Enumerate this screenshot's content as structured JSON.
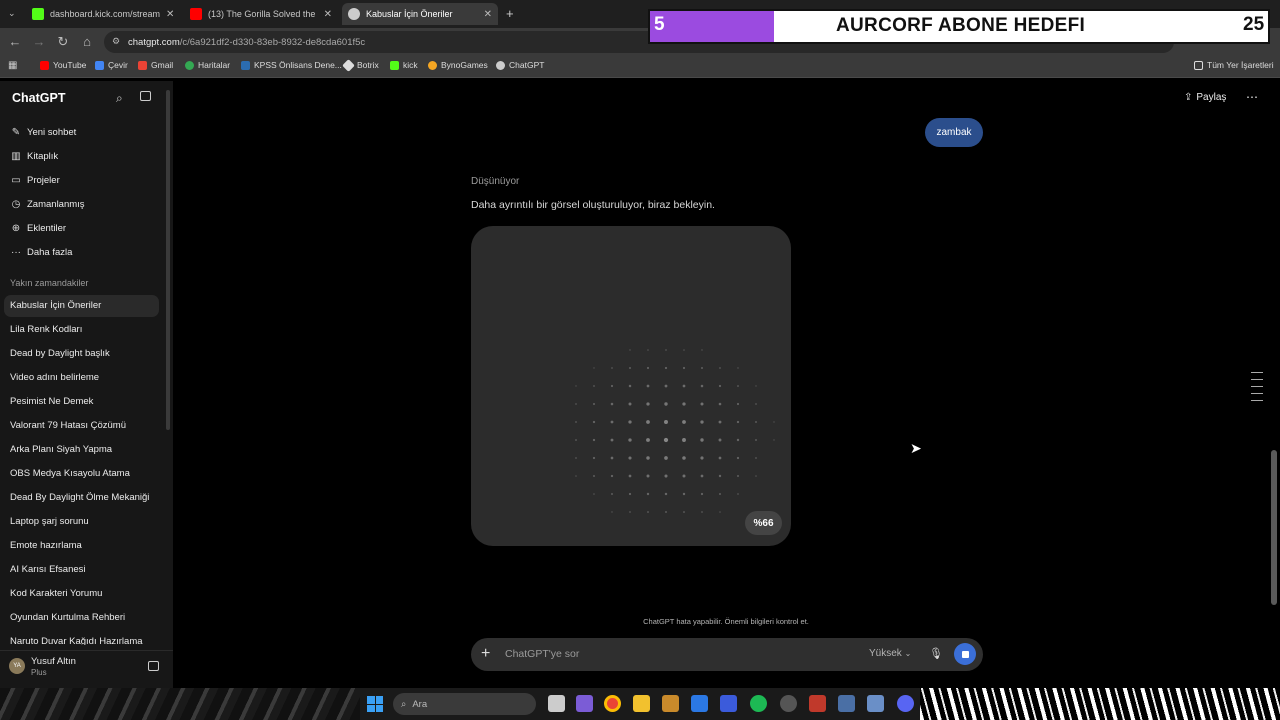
{
  "browser": {
    "tabs": [
      {
        "title": "dashboard.kick.com/stream",
        "favicon_color": "#53fc18"
      },
      {
        "title": "(13) The Gorilla Solved the Puzz",
        "favicon_color": "#ff0000"
      },
      {
        "title": "Kabuslar İçin Öneriler",
        "favicon_color": "#cccccc"
      }
    ],
    "new_tab": "+",
    "url_host": "chatgpt.com",
    "url_path": "/c/6a921df2-d330-83eb-8932-de8cda601f5c",
    "bookmarks": [
      {
        "label": "YouTube",
        "color": "#ff0000"
      },
      {
        "label": "Çevir",
        "color": "#4285f4"
      },
      {
        "label": "Gmail",
        "color": "#ea4335"
      },
      {
        "label": "Haritalar",
        "color": "#34a853"
      },
      {
        "label": "KPSS Önlisans Dene...",
        "color": "#2b6cb0"
      },
      {
        "label": "Botrix",
        "color": "#dddddd"
      },
      {
        "label": "kick",
        "color": "#53fc18"
      },
      {
        "label": "BynoGames",
        "color": "#f5a623"
      },
      {
        "label": "ChatGPT",
        "color": "#cccccc"
      }
    ],
    "all_bookmarks": "Tüm Yer İşaretleri"
  },
  "stream_overlay": {
    "count": "5",
    "title": "AURCORF ABONE HEDEFI",
    "goal": "25",
    "accent": "#9b4be0"
  },
  "sidebar": {
    "logo": "ChatGPT",
    "nav": [
      {
        "label": "Yeni sohbet",
        "icon": "✎"
      },
      {
        "label": "Kitaplık",
        "icon": "▥"
      },
      {
        "label": "Projeler",
        "icon": "▭"
      },
      {
        "label": "Zamanlanmış",
        "icon": "◷"
      },
      {
        "label": "Eklentiler",
        "icon": "⊕"
      },
      {
        "label": "Daha fazla",
        "icon": "···"
      }
    ],
    "recent_heading": "Yakın zamandakiler",
    "conversations": [
      "Kabuslar İçin Öneriler",
      "Lila Renk Kodları",
      "Dead by Daylight başlık",
      "Video adını belirleme",
      "Pesimist Ne Demek",
      "Valorant 79 Hatası Çözümü",
      "Arka Planı Siyah Yapma",
      "OBS Medya Kısayolu Atama",
      "Dead By Daylight Ölme Mekaniği",
      "Laptop şarj sorunu",
      "Emote hazırlama",
      "AI Karısı Efsanesi",
      "Kod Karakteri Yorumu",
      "Oyundan Kurtulma Rehberi",
      "Naruto Duvar Kağıdı Hazırlama"
    ],
    "user": {
      "initials": "YA",
      "name": "Yusuf Altın",
      "plan": "Plus"
    }
  },
  "header": {
    "share": "Paylaş"
  },
  "chat": {
    "user_message": "zambak",
    "thinking": "Düşünüyor",
    "assistant_message": "Daha ayrıntılı bir görsel oluşturuluyor, biraz bekleyin.",
    "progress": "%66",
    "progress_value": 66,
    "disclaimer": "ChatGPT hata yapabilir. Önemli bilgileri kontrol et."
  },
  "composer": {
    "placeholder": "ChatGPT'ye sor",
    "quality": "Yüksek"
  },
  "taskbar": {
    "search": "Ara"
  }
}
